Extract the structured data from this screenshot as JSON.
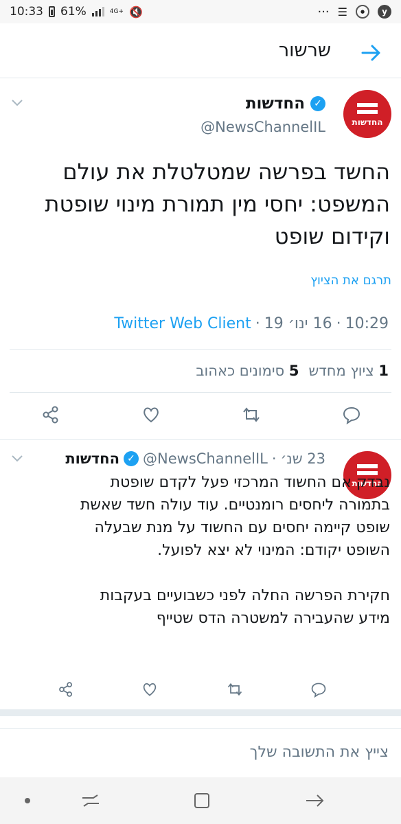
{
  "status_bar": {
    "time": "10:33",
    "battery": "61%",
    "network": "4G+",
    "more": "···"
  },
  "header": {
    "title": "שרשור"
  },
  "main_tweet": {
    "avatar_label": "החדשות",
    "name": "החדשות",
    "handle": "@NewsChannelIL",
    "text": "החשד בפרשה שמטלטלת את עולם המשפט: יחסי מין תמורת מינוי שופטת וקידום שופט",
    "translate_label": "תרגם את הציוץ",
    "time": "10:29",
    "date": "16 ינו׳ 19",
    "source": "Twitter Web Client",
    "retweets_count": "1",
    "retweets_label": "ציוץ מחדש",
    "likes_count": "5",
    "likes_label": "סימונים כאהוב"
  },
  "reply_tweet": {
    "avatar_label": "החדשות",
    "name": "החדשות",
    "handle": "@NewsChannelIL",
    "date": "23 שנ׳",
    "paragraph1": "נבדק אם החשוד המרכזי פעל לקדם שופטת בתמורה ליחסים רומנטיים. עוד עולה חשד שאשת שופט קיימה יחסים עם החשוד על מנת שבעלה השופט יקודם: המינוי לא יצא לפועל.",
    "paragraph2": "חקירת הפרשה החלה לפני כשבועיים בעקבות מידע שהעבירה למשטרה הדס שטייף"
  },
  "reply_box": {
    "placeholder": "צייץ את התשובה שלך"
  },
  "colors": {
    "accent": "#1da1f2",
    "brand": "#d01f27",
    "muted": "#657786"
  }
}
